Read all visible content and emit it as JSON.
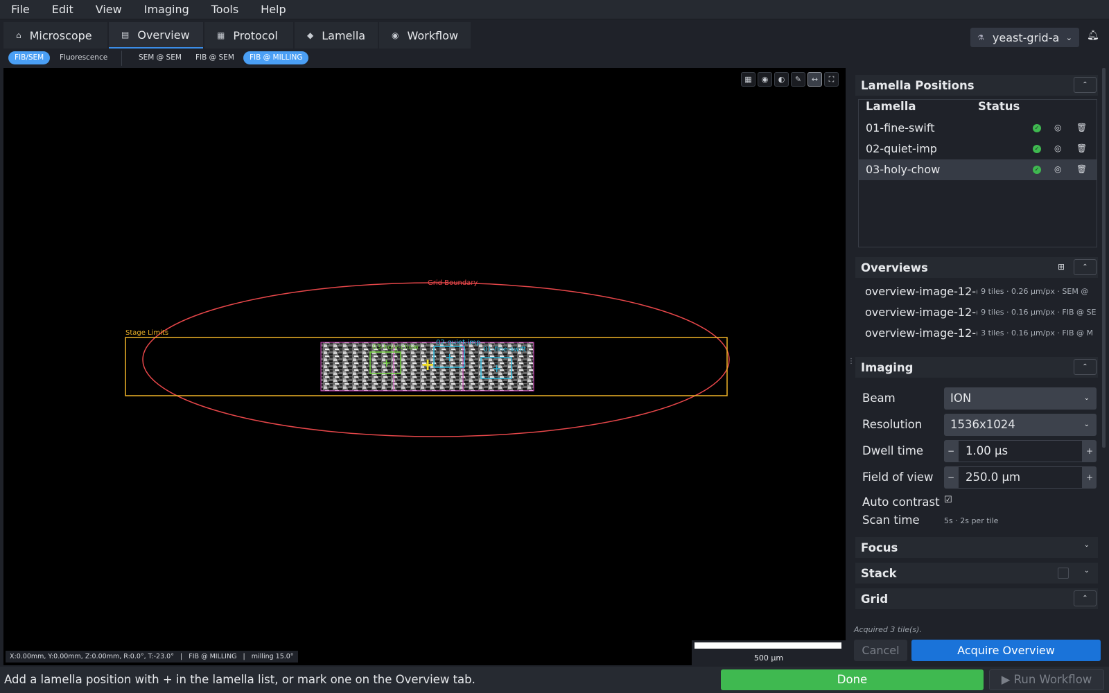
{
  "menu": [
    "File",
    "Edit",
    "View",
    "Imaging",
    "Tools",
    "Help"
  ],
  "tabs": [
    {
      "label": "Microscope",
      "icon": "microscope-icon",
      "active": false
    },
    {
      "label": "Overview",
      "icon": "map-icon",
      "active": true
    },
    {
      "label": "Protocol",
      "icon": "document-icon",
      "active": false
    },
    {
      "label": "Lamella",
      "icon": "layers-icon",
      "active": false
    },
    {
      "label": "Workflow",
      "icon": "play-circle-icon",
      "active": false
    }
  ],
  "project": {
    "name": "yeast-grid-a",
    "icon": "flask-icon"
  },
  "subtabs": [
    {
      "label": "FIB/SEM",
      "active": true
    },
    {
      "label": "Fluorescence",
      "active": false
    },
    {
      "label": "SEM @ SEM",
      "active": false
    },
    {
      "label": "FIB @ SEM",
      "active": false
    },
    {
      "label": "FIB @ MILLING",
      "active": true
    }
  ],
  "viewer": {
    "tools": [
      "grid-icon",
      "eye-icon",
      "contrast-icon",
      "pen-icon",
      "ruler-icon",
      "fit-icon"
    ],
    "grid_boundary_label": "Grid Boundary",
    "stage_limits_label": "Stage Limits",
    "lamella_labels": [
      "03-holy-chow",
      "02-quiet-imp",
      "01-fine-swift"
    ],
    "status": "X:0.00mm, Y:0.00mm, Z:0.00mm, R:0.0°, T:-23.0°   |   FIB @ MILLING   |   milling 15.0°",
    "scale_label": "500 µm",
    "colors": {
      "grid_boundary": "#e8474a",
      "stage_limits": "#f0b429",
      "lamella_green": "#6fd13a",
      "lamella_cyan": "#29b6d9",
      "tile_outline": "#d43fc0"
    }
  },
  "panel": {
    "lamella_positions": {
      "title": "Lamella Positions",
      "headers": [
        "Lamella",
        "Status"
      ],
      "rows": [
        {
          "name": "01-fine-swift",
          "status": "ok"
        },
        {
          "name": "02-quiet-imp",
          "status": "ok"
        },
        {
          "name": "03-holy-chow",
          "status": "ok",
          "selected": true
        }
      ]
    },
    "overviews": {
      "title": "Overviews",
      "items": [
        {
          "name": "overview-image-12-(",
          "meta": "9 tiles · 0.26 µm/px · SEM @"
        },
        {
          "name": "overview-image-12-(",
          "meta": "9 tiles · 0.16 µm/px · FIB @ SE"
        },
        {
          "name": "overview-image-12-(",
          "meta": "3 tiles · 0.16 µm/px · FIB @ M"
        }
      ]
    },
    "imaging": {
      "title": "Imaging",
      "beam_label": "Beam",
      "beam_value": "ION",
      "resolution_label": "Resolution",
      "resolution_value": "1536x1024",
      "dwell_label": "Dwell time",
      "dwell_value": "1.00  µs",
      "fov_label": "Field of view",
      "fov_value": "250.0  µm",
      "auto_contrast_label": "Auto contrast",
      "auto_contrast_checked": true,
      "scan_time_label": "Scan time",
      "scan_time_value": "5s  ·  2s per tile"
    },
    "focus_title": "Focus",
    "stack_title": "Stack",
    "grid_title": "Grid"
  },
  "acquired_msg": "Acquired 3 tile(s).",
  "cancel_label": "Cancel",
  "acquire_label": "Acquire Overview",
  "footer": {
    "message": "Add a lamella position with + in the lamella list, or mark one on the Overview tab.",
    "done_label": "Done",
    "run_label": "Run Workflow"
  }
}
